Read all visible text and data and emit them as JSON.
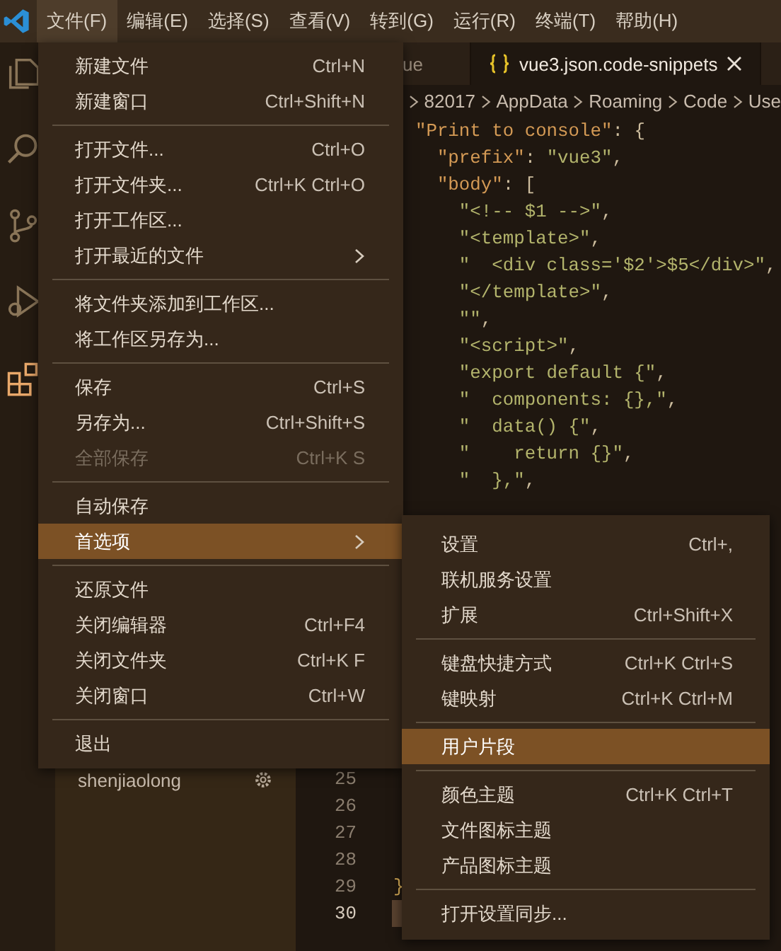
{
  "title_bar": {
    "menus": [
      {
        "label": "文件(F)",
        "selected": true
      },
      {
        "label": "编辑(E)",
        "selected": false
      },
      {
        "label": "选择(S)",
        "selected": false
      },
      {
        "label": "查看(V)",
        "selected": false
      },
      {
        "label": "转到(G)",
        "selected": false
      },
      {
        "label": "运行(R)",
        "selected": false
      },
      {
        "label": "终端(T)",
        "selected": false
      },
      {
        "label": "帮助(H)",
        "selected": false
      }
    ]
  },
  "activity_bar": {
    "items": [
      {
        "kind": "explorer",
        "selected": false
      },
      {
        "kind": "search",
        "selected": false
      },
      {
        "kind": "source-control",
        "selected": false
      },
      {
        "kind": "debug",
        "selected": false
      },
      {
        "kind": "extensions",
        "selected": true
      }
    ]
  },
  "sidebar": {
    "items": [
      {
        "label": "shenjiaolong"
      }
    ]
  },
  "editor": {
    "tabs": [
      {
        "label": "ue",
        "selected": false
      },
      {
        "label": "vue3.json.code-snippets",
        "selected": true,
        "icon": true
      }
    ],
    "breadcrumb": [
      "82017",
      "AppData",
      "Roaming",
      "Code",
      "Use"
    ],
    "lines_top": [
      {
        "segments": [
          {
            "kind": "key",
            "text": "  \"Print to console\""
          },
          {
            "kind": "punct",
            "text": ": {"
          }
        ]
      },
      {
        "segments": [
          {
            "kind": "key",
            "text": "    \"prefix\""
          },
          {
            "kind": "punct",
            "text": ": "
          },
          {
            "kind": "string",
            "text": "\"vue3\""
          },
          {
            "kind": "punct",
            "text": ","
          }
        ]
      },
      {
        "segments": [
          {
            "kind": "key",
            "text": "    \"body\""
          },
          {
            "kind": "punct",
            "text": ": ["
          }
        ]
      },
      {
        "segments": [
          {
            "kind": "string",
            "text": "      \"<!-- $1 -->\""
          },
          {
            "kind": "punct",
            "text": ","
          }
        ]
      },
      {
        "segments": [
          {
            "kind": "string",
            "text": "      \"<template>\""
          },
          {
            "kind": "punct",
            "text": ","
          }
        ]
      },
      {
        "segments": [
          {
            "kind": "string",
            "text": "      \"  <div class='$2'>$5</div>\""
          },
          {
            "kind": "punct",
            "text": ","
          }
        ]
      },
      {
        "segments": [
          {
            "kind": "string",
            "text": "      \"</template>\""
          },
          {
            "kind": "punct",
            "text": ","
          }
        ]
      },
      {
        "segments": [
          {
            "kind": "string",
            "text": "      \"\""
          },
          {
            "kind": "punct",
            "text": ","
          }
        ]
      },
      {
        "segments": [
          {
            "kind": "string",
            "text": "      \"<script>\""
          },
          {
            "kind": "punct",
            "text": ","
          }
        ]
      },
      {
        "segments": [
          {
            "kind": "string",
            "text": "      \"export default {\""
          },
          {
            "kind": "punct",
            "text": ","
          }
        ]
      },
      {
        "segments": [
          {
            "kind": "string",
            "text": "      \"  components: {},\""
          },
          {
            "kind": "punct",
            "text": ","
          }
        ]
      },
      {
        "segments": [
          {
            "kind": "string",
            "text": "      \"  data() {\""
          },
          {
            "kind": "punct",
            "text": ","
          }
        ]
      },
      {
        "segments": [
          {
            "kind": "string",
            "text": "      \"    return {}\""
          },
          {
            "kind": "punct",
            "text": ","
          }
        ]
      },
      {
        "segments": [
          {
            "kind": "string",
            "text": "      \"  },\""
          },
          {
            "kind": "punct",
            "text": ","
          }
        ]
      }
    ],
    "lines_bottom": [
      {
        "number": "25",
        "cursor": false
      },
      {
        "number": "26",
        "cursor": false
      },
      {
        "number": "27",
        "cursor": false
      },
      {
        "number": "28",
        "cursor": false
      },
      {
        "number": "29",
        "text": "}",
        "cursor": false
      },
      {
        "number": "30",
        "cursor": true
      }
    ]
  },
  "file_menu": {
    "items": [
      {
        "kind": "item",
        "label": "新建文件",
        "shortcut": "Ctrl+N",
        "selected": false,
        "disabled": false
      },
      {
        "kind": "item",
        "label": "新建窗口",
        "shortcut": "Ctrl+Shift+N",
        "selected": false,
        "disabled": false
      },
      {
        "kind": "separator"
      },
      {
        "kind": "item",
        "label": "打开文件...",
        "shortcut": "Ctrl+O",
        "selected": false,
        "disabled": false
      },
      {
        "kind": "item",
        "label": "打开文件夹...",
        "shortcut": "Ctrl+K Ctrl+O",
        "selected": false,
        "disabled": false
      },
      {
        "kind": "item",
        "label": "打开工作区...",
        "selected": false,
        "disabled": false
      },
      {
        "kind": "submenu",
        "label": "打开最近的文件",
        "selected": false,
        "disabled": false
      },
      {
        "kind": "separator"
      },
      {
        "kind": "item",
        "label": "将文件夹添加到工作区...",
        "selected": false,
        "disabled": false
      },
      {
        "kind": "item",
        "label": "将工作区另存为...",
        "selected": false,
        "disabled": false
      },
      {
        "kind": "separator"
      },
      {
        "kind": "item",
        "label": "保存",
        "shortcut": "Ctrl+S",
        "selected": false,
        "disabled": false
      },
      {
        "kind": "item",
        "label": "另存为...",
        "shortcut": "Ctrl+Shift+S",
        "selected": false,
        "disabled": false
      },
      {
        "kind": "item",
        "label": "全部保存",
        "shortcut": "Ctrl+K S",
        "selected": false,
        "disabled": true
      },
      {
        "kind": "separator"
      },
      {
        "kind": "item",
        "label": "自动保存",
        "selected": false,
        "disabled": false
      },
      {
        "kind": "submenu",
        "label": "首选项",
        "selected": true,
        "disabled": false,
        "submenu": {
          "items": [
            {
              "kind": "item",
              "label": "设置",
              "shortcut": "Ctrl+,",
              "selected": false,
              "disabled": false
            },
            {
              "kind": "item",
              "label": "联机服务设置",
              "selected": false,
              "disabled": false
            },
            {
              "kind": "item",
              "label": "扩展",
              "shortcut": "Ctrl+Shift+X",
              "selected": false,
              "disabled": false
            },
            {
              "kind": "separator"
            },
            {
              "kind": "item",
              "label": "键盘快捷方式",
              "shortcut": "Ctrl+K Ctrl+S",
              "selected": false,
              "disabled": false
            },
            {
              "kind": "item",
              "label": "键映射",
              "shortcut": "Ctrl+K Ctrl+M",
              "selected": false,
              "disabled": false
            },
            {
              "kind": "separator"
            },
            {
              "kind": "item",
              "label": "用户片段",
              "selected": true,
              "disabled": false
            },
            {
              "kind": "separator"
            },
            {
              "kind": "item",
              "label": "颜色主题",
              "shortcut": "Ctrl+K Ctrl+T",
              "selected": false,
              "disabled": false
            },
            {
              "kind": "item",
              "label": "文件图标主题",
              "selected": false,
              "disabled": false
            },
            {
              "kind": "item",
              "label": "产品图标主题",
              "selected": false,
              "disabled": false
            },
            {
              "kind": "separator"
            },
            {
              "kind": "item",
              "label": "打开设置同步...",
              "selected": false,
              "disabled": false
            }
          ]
        }
      },
      {
        "kind": "separator"
      },
      {
        "kind": "item",
        "label": "还原文件",
        "selected": false,
        "disabled": false
      },
      {
        "kind": "item",
        "label": "关闭编辑器",
        "shortcut": "Ctrl+F4",
        "selected": false,
        "disabled": false
      },
      {
        "kind": "item",
        "label": "关闭文件夹",
        "shortcut": "Ctrl+K F",
        "selected": false,
        "disabled": false
      },
      {
        "kind": "item",
        "label": "关闭窗口",
        "shortcut": "Ctrl+W",
        "selected": false,
        "disabled": false
      },
      {
        "kind": "separator"
      },
      {
        "kind": "item",
        "label": "退出",
        "selected": false,
        "disabled": false
      }
    ]
  }
}
